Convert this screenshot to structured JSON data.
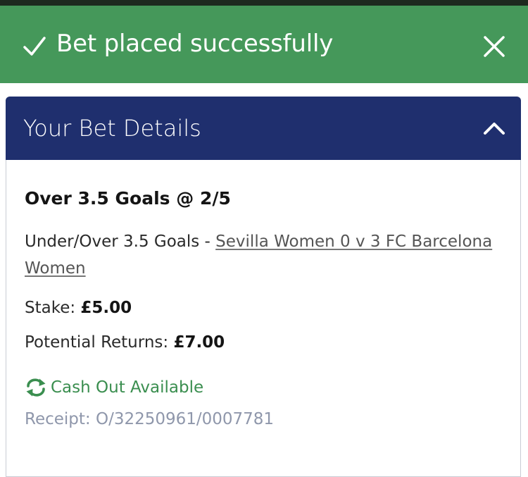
{
  "banner": {
    "message": "Bet placed successfully",
    "icon": "checkmark-icon",
    "close_icon": "close-icon",
    "color": "#45985a"
  },
  "bet_details": {
    "title": "Your Bet Details",
    "header_color": "#1f2f6e",
    "toggle_icon": "chevron-up-icon",
    "selection": "Over 3.5 Goals @ 2/5",
    "market_prefix": "Under/Over 3.5 Goals - ",
    "event": "Sevilla Women 0 v 3 FC Barcelona Women",
    "stake_label": "Stake: ",
    "stake_value": "£5.00",
    "returns_label": "Potential Returns: ",
    "returns_value": "£7.00",
    "cashout_icon": "refresh-icon",
    "cashout_label": "Cash Out Available",
    "cashout_color": "#3a8e4f",
    "receipt": "Receipt: O/32250961/0007781"
  }
}
